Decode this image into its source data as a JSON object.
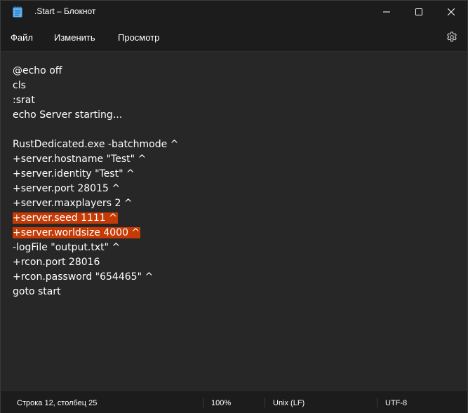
{
  "window": {
    "title": ".Start – Блокнот",
    "icon": "notepad-icon"
  },
  "menu": {
    "file": "Файл",
    "edit": "Изменить",
    "view": "Просмотр",
    "settings_icon": "gear-icon"
  },
  "editor": {
    "lines": [
      "@echo off",
      "cls",
      ":srat",
      "echo Server starting...",
      "",
      "RustDedicated.exe -batchmode ^",
      "+server.hostname \"Test\" ^",
      "+server.identity \"Test\" ^",
      "+server.port 28015 ^",
      "+server.maxplayers 2 ^",
      "+server.seed 1111 ^",
      "+server.worldsize 4000 ^",
      "-logFile \"output.txt\" ^",
      "+rcon.port 28016",
      "+rcon.password \"654465\" ^",
      "goto start"
    ],
    "selection_color": "#c63b05"
  },
  "status": {
    "position": "Строка 12, столбец 25",
    "zoom": "100%",
    "line_ending": "Unix (LF)",
    "encoding": "UTF-8"
  }
}
